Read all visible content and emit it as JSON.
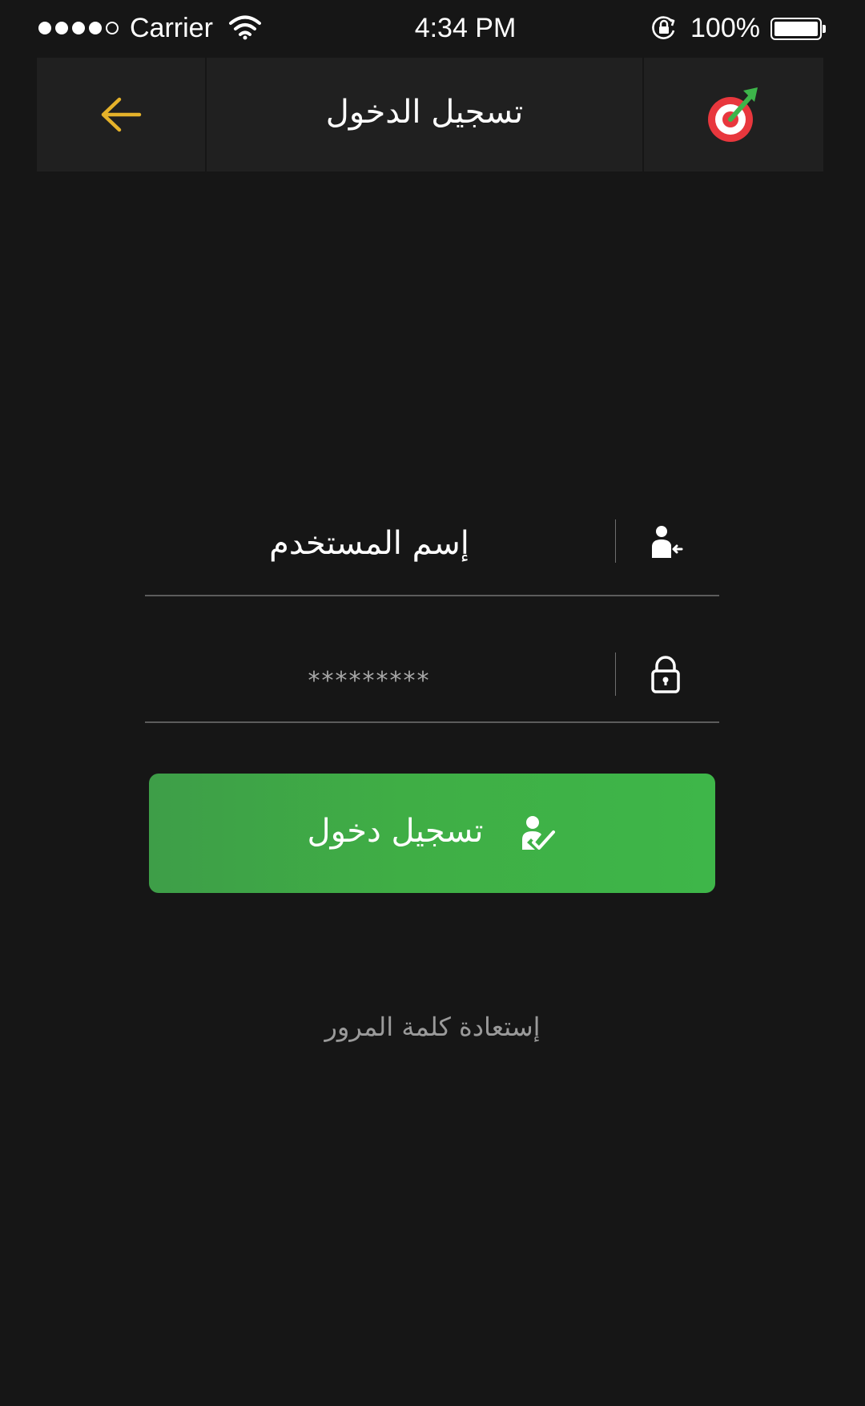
{
  "status_bar": {
    "signal_strength": 4,
    "signal_max": 5,
    "carrier": "Carrier",
    "time": "4:34 PM",
    "battery_percent": "100%",
    "battery_level": 1.0,
    "icons": [
      "signal-dots-icon",
      "wifi-icon",
      "rotation-lock-icon",
      "battery-icon"
    ]
  },
  "nav": {
    "title": "تسجيل الدخول",
    "back_icon": "arrow-left-icon",
    "logo_icon": "target-arrow-logo-icon"
  },
  "form": {
    "username": {
      "placeholder": "إسم المستخدم",
      "value": "",
      "icon": "user-login-icon"
    },
    "password": {
      "placeholder": "*********",
      "value": "",
      "icon": "lock-icon"
    },
    "submit": {
      "label": "تسجيل دخول",
      "icon": "user-check-icon"
    },
    "forgot_password": "إستعادة كلمة المرور"
  },
  "colors": {
    "background": "#161616",
    "nav_background": "#202020",
    "accent_back_arrow": "#e5b22a",
    "button_green": "#3fae45",
    "logo_red": "#e8373d",
    "logo_green": "#3db54a",
    "divider": "#5c5c5c",
    "link_text": "#9a9a9a"
  }
}
